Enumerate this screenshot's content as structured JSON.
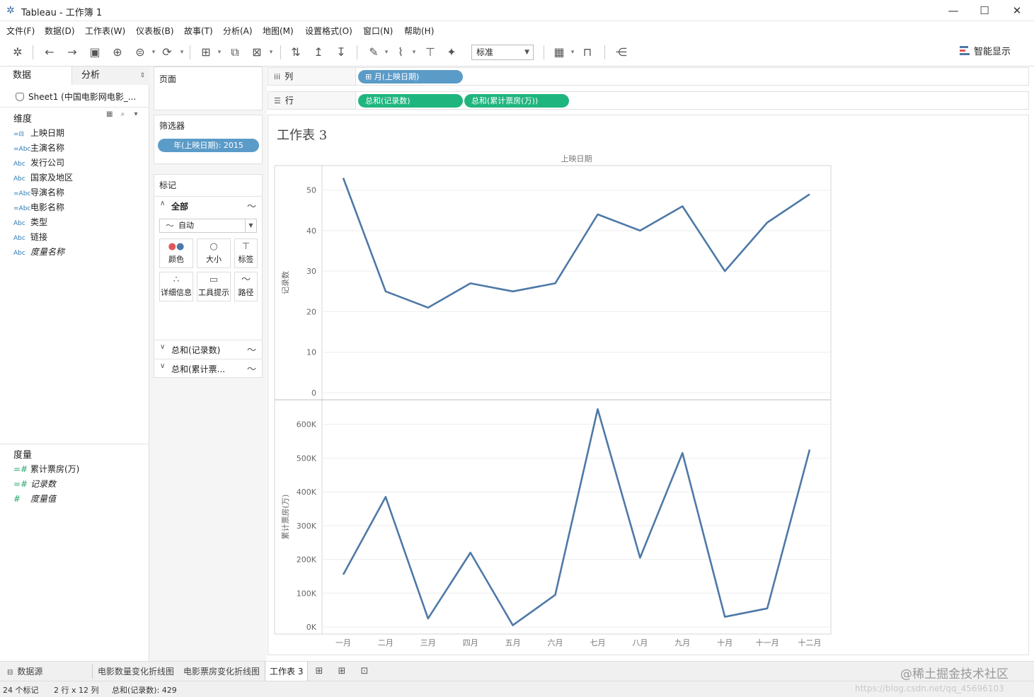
{
  "window": {
    "title": "Tableau - 工作簿 1",
    "buttons": {
      "minimize": "—",
      "maximize": "☐",
      "close": "✕"
    }
  },
  "menu": [
    "文件(F)",
    "数据(D)",
    "工作表(W)",
    "仪表板(B)",
    "故事(T)",
    "分析(A)",
    "地图(M)",
    "设置格式(O)",
    "窗口(N)",
    "帮助(H)"
  ],
  "toolbar": {
    "fit_select": "标准",
    "smart_show": "智能显示"
  },
  "data_pane": {
    "tab_data": "数据",
    "tab_analysis": "分析",
    "source": "Sheet1 (中国电影网电影_...",
    "dimensions_label": "维度",
    "dimensions": [
      {
        "icon": "=⊟",
        "label": "上映日期"
      },
      {
        "icon": "=Abc",
        "label": "主演名称"
      },
      {
        "icon": "Abc",
        "label": "发行公司"
      },
      {
        "icon": "Abc",
        "label": "国家及地区"
      },
      {
        "icon": "=Abc",
        "label": "导演名称"
      },
      {
        "icon": "=Abc",
        "label": "电影名称"
      },
      {
        "icon": "Abc",
        "label": "类型"
      },
      {
        "icon": "Abc",
        "label": "链接"
      },
      {
        "icon": "Abc",
        "label": "度量名称"
      }
    ],
    "measures_label": "度量",
    "measures": [
      {
        "icon": "=#",
        "label": "累计票房(万)"
      },
      {
        "icon": "=#",
        "label": "记录数"
      },
      {
        "icon": "#",
        "label": "度量值"
      }
    ]
  },
  "shelves": {
    "pages_label": "页面",
    "filters_label": "筛选器",
    "filter_pill": "年(上映日期): 2015",
    "marks_label": "标记",
    "marks_all": "全部",
    "mark_type": "自动",
    "mark_buttons": [
      "颜色",
      "大小",
      "标签",
      "详细信息",
      "工具提示",
      "路径"
    ],
    "marks_measures": [
      "总和(记录数)",
      "总和(累计票..."
    ],
    "columns_label": "列",
    "columns_pill": "⊞ 月(上映日期)",
    "rows_label": "行",
    "rows_pills": [
      "总和(记录数)",
      "总和(累计票房(万))"
    ]
  },
  "sheet_title": "工作表 3",
  "chart_data": [
    {
      "type": "line",
      "title": "上映日期",
      "categories": [
        "一月",
        "二月",
        "三月",
        "四月",
        "五月",
        "六月",
        "七月",
        "八月",
        "九月",
        "十月",
        "十一月",
        "十二月"
      ],
      "ylabel": "记录数",
      "ylim": [
        0,
        55
      ],
      "yticks": [
        "50",
        "40",
        "30",
        "20",
        "10",
        "0"
      ],
      "ytick_values": [
        50,
        40,
        30,
        20,
        10,
        0
      ],
      "values": [
        53,
        25,
        21,
        27,
        25,
        27,
        44,
        40,
        46,
        30,
        42,
        49
      ],
      "color": "#4e79a7"
    },
    {
      "type": "line",
      "categories": [
        "一月",
        "二月",
        "三月",
        "四月",
        "五月",
        "六月",
        "七月",
        "八月",
        "九月",
        "十月",
        "十一月",
        "十二月"
      ],
      "ylabel": "累计票房(万)",
      "ylim": [
        0,
        660000
      ],
      "yticks": [
        "600K",
        "500K",
        "400K",
        "300K",
        "200K",
        "100K",
        "0K"
      ],
      "ytick_values": [
        600000,
        500000,
        400000,
        300000,
        200000,
        100000,
        0
      ],
      "values": [
        155000,
        385000,
        25000,
        220000,
        5000,
        95000,
        645000,
        205000,
        515000,
        30000,
        55000,
        525000
      ],
      "color": "#4e79a7"
    }
  ],
  "bottom_tabs": {
    "datasource": "数据源",
    "sheets": [
      "电影数量变化折线图",
      "电影票房变化折线图",
      "工作表 3"
    ],
    "watermark": "@稀土掘金技术社区"
  },
  "status": {
    "marks": "24 个标记",
    "dims": "2 行 x 12 列",
    "sum": "总和(记录数): 429",
    "url": "https://blog.csdn.net/qq_45696103"
  }
}
